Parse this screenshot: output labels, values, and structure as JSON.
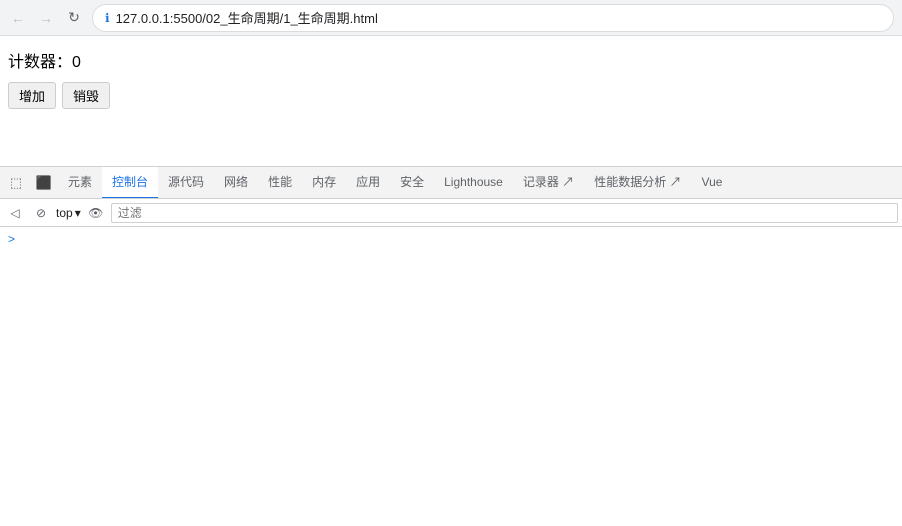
{
  "browser": {
    "url": "127.0.0.1:5500/02_生命周期/1_生命周期.html",
    "lock_icon": "ℹ"
  },
  "page": {
    "counter_label": "计数器：",
    "counter_value": "0",
    "btn_add": "增加",
    "btn_destroy": "销毁"
  },
  "devtools": {
    "tabs": [
      {
        "label": "元素",
        "id": "elements",
        "active": false
      },
      {
        "label": "控制台",
        "id": "console",
        "active": true
      },
      {
        "label": "源代码",
        "id": "sources",
        "active": false
      },
      {
        "label": "网络",
        "id": "network",
        "active": false
      },
      {
        "label": "性能",
        "id": "performance",
        "active": false
      },
      {
        "label": "内存",
        "id": "memory",
        "active": false
      },
      {
        "label": "应用",
        "id": "application",
        "active": false
      },
      {
        "label": "安全",
        "id": "security",
        "active": false
      },
      {
        "label": "Lighthouse",
        "id": "lighthouse",
        "active": false
      },
      {
        "label": "记录器 ↗",
        "id": "recorder",
        "active": false
      },
      {
        "label": "性能数据分析 ↗",
        "id": "perf-insights",
        "active": false
      },
      {
        "label": "Vue",
        "id": "vue",
        "active": false
      }
    ],
    "console": {
      "context": "top",
      "filter_placeholder": "过滤",
      "arrow": ">"
    }
  },
  "icons": {
    "back": "←",
    "forward": "→",
    "reload": "↻",
    "info": "ℹ",
    "inspect": "⬚",
    "device": "□",
    "clear_console": "🚫",
    "stop_recording": "⊘",
    "dropdown": "▾",
    "eye": "👁",
    "sidebar_toggle": "◁",
    "cursor_icon": "⋮",
    "mobile_icon": "⬛"
  }
}
